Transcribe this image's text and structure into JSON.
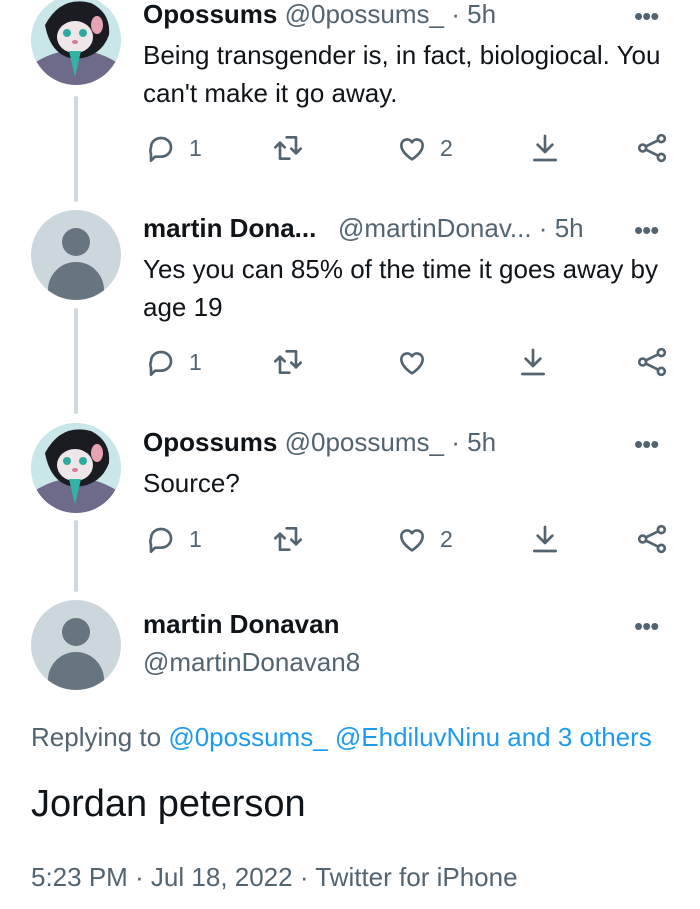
{
  "tweets": [
    {
      "name": "Opossums",
      "handle": "@0possums_",
      "time": "5h",
      "dot": "·",
      "text": "Being transgender is, in fact, biologiocal. You can't make it go away.",
      "replies": "1",
      "likes": "2"
    },
    {
      "name": "martin Dona...",
      "handle": "@martinDonav...",
      "time": "5h",
      "dot": "·",
      "text": "Yes you can 85% of the time it goes away by age 19",
      "replies": "1",
      "likes": ""
    },
    {
      "name": "Opossums",
      "handle": "@0possums_",
      "time": "5h",
      "dot": "·",
      "text": "Source?",
      "replies": "1",
      "likes": "2"
    }
  ],
  "main_tweet": {
    "name": "martin Donavan",
    "handle": "@martinDonavan8",
    "replying_prefix": "Replying to",
    "replying_links": "@0possums_ @EhdiluvNinu and 3 others",
    "text": "Jordan peterson",
    "meta": "5:23 PM · Jul 18, 2022 · Twitter for iPhone"
  },
  "more_symbol": "•••",
  "colors": {
    "link": "#1d9bf0",
    "secondary": "#536471",
    "thread_line": "#cfd9de"
  },
  "icons": [
    "reply-icon",
    "retweet-icon",
    "like-icon",
    "download-icon",
    "share-icon"
  ]
}
